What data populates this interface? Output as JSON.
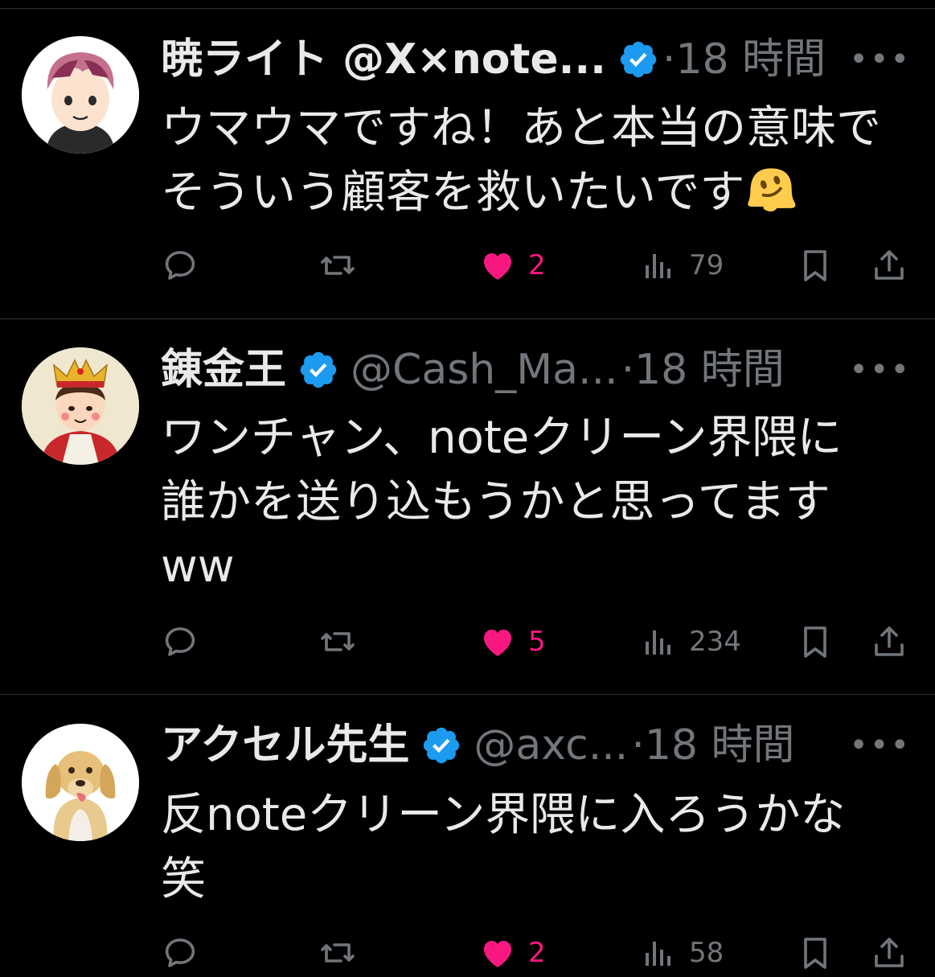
{
  "accent": "#1d9bf0",
  "like_color": "#f91880",
  "muted_color": "#71767b",
  "icons": [
    "reply-icon",
    "retweet-icon",
    "like-icon",
    "views-icon",
    "bookmark-icon",
    "share-icon",
    "more-icon",
    "verified-icon"
  ],
  "tweets": [
    {
      "display_name": "暁ライト @X×note...",
      "handle": "",
      "separator": "·",
      "time": "18 時間",
      "more": "•••",
      "text": "ウマウマですね！あと本当の意味で\nそういう顧客を救いたいです",
      "emoji": "melting-face",
      "liked": true,
      "likes": "2",
      "views": "79"
    },
    {
      "display_name": "錬金王",
      "handle": "@Cash_Ma...",
      "separator": "·",
      "time": "18 時間",
      "more": "•••",
      "text": "ワンチャン、noteクリーン界隈に\n誰かを送り込もうかと思ってます\nww",
      "liked": true,
      "likes": "5",
      "views": "234"
    },
    {
      "display_name": "アクセル先生",
      "handle": "@axc...",
      "separator": "·",
      "time": "18 時間",
      "more": "•••",
      "text": "反noteクリーン界隈に入ろうかな\n笑",
      "liked": true,
      "likes": "2",
      "views": "58"
    }
  ]
}
